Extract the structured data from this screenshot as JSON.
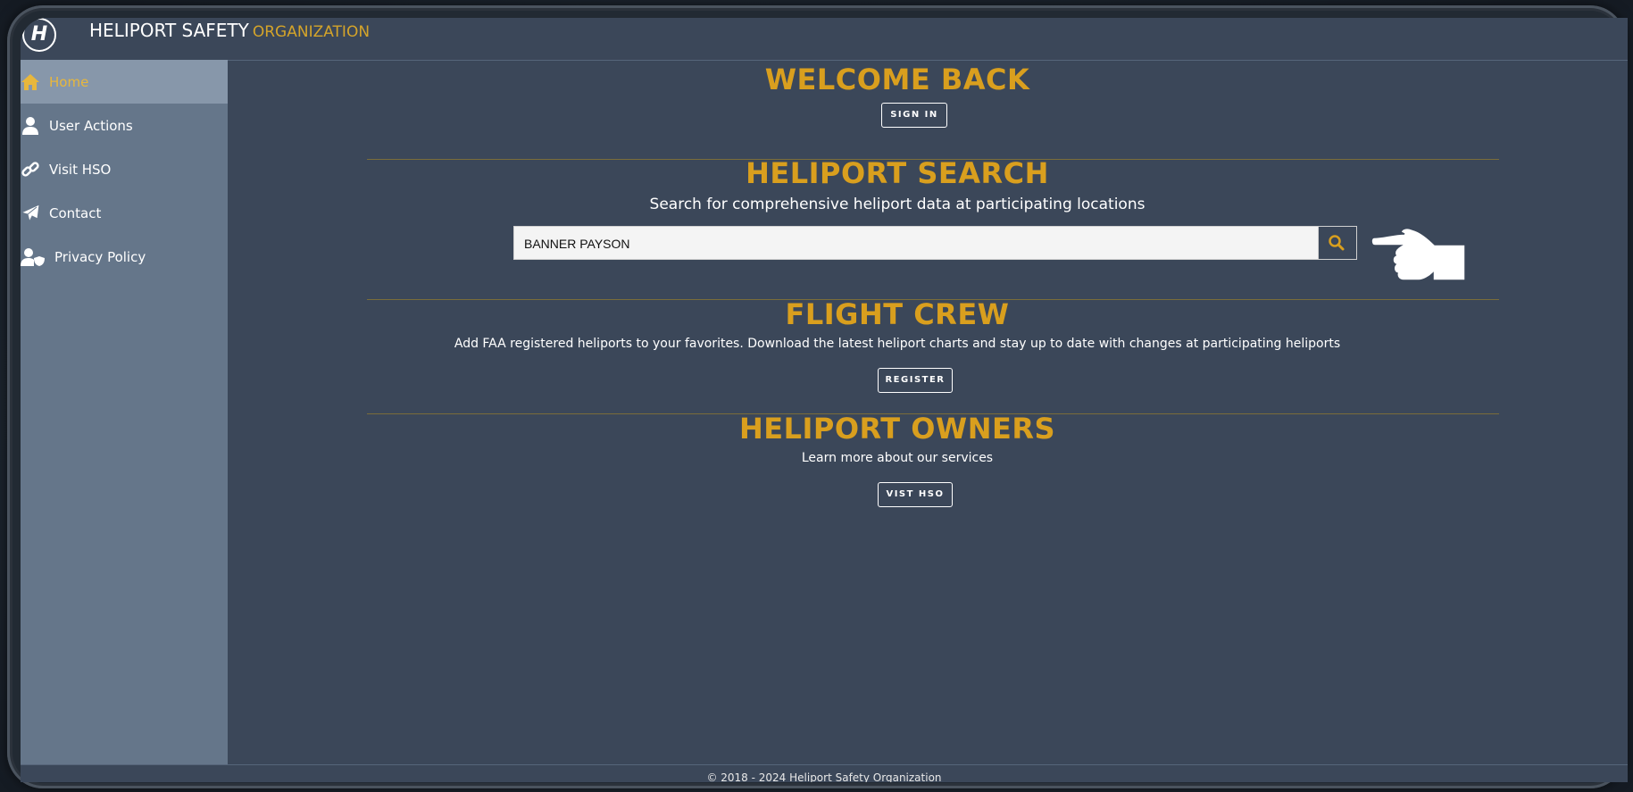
{
  "header": {
    "brand_primary": "HELIPORT SAFETY",
    "brand_secondary": "ORGANIZATION",
    "logo_letter": "H"
  },
  "sidebar": {
    "items": [
      {
        "label": "Home",
        "icon": "home-icon",
        "active": true
      },
      {
        "label": "User Actions",
        "icon": "user-icon",
        "active": false
      },
      {
        "label": "Visit HSO",
        "icon": "link-icon",
        "active": false
      },
      {
        "label": "Contact",
        "icon": "paper-plane-icon",
        "active": false
      },
      {
        "label": "Privacy Policy",
        "icon": "user-shield-icon",
        "active": false
      }
    ]
  },
  "main": {
    "welcome": {
      "title": "WELCOME BACK",
      "button": "SIGN IN"
    },
    "search": {
      "title": "HELIPORT SEARCH",
      "subtitle": "Search for comprehensive heliport data at participating locations",
      "value": "BANNER PAYSON",
      "placeholder": ""
    },
    "crew": {
      "title": "FLIGHT CREW",
      "text": "Add FAA registered heliports to your favorites. Download the latest heliport charts and stay up to date with changes at participating heliports",
      "button": "REGISTER"
    },
    "owners": {
      "title": "HELIPORT OWNERS",
      "text": "Learn more about our services",
      "button": "VIST HSO"
    }
  },
  "footer": {
    "text": "© 2018 - 2024 Heliport Safety Organization"
  },
  "colors": {
    "accent": "#d99f1e",
    "background": "#3b4759",
    "sidebar": "#65768a",
    "sidebar_active": "#8797aa"
  }
}
